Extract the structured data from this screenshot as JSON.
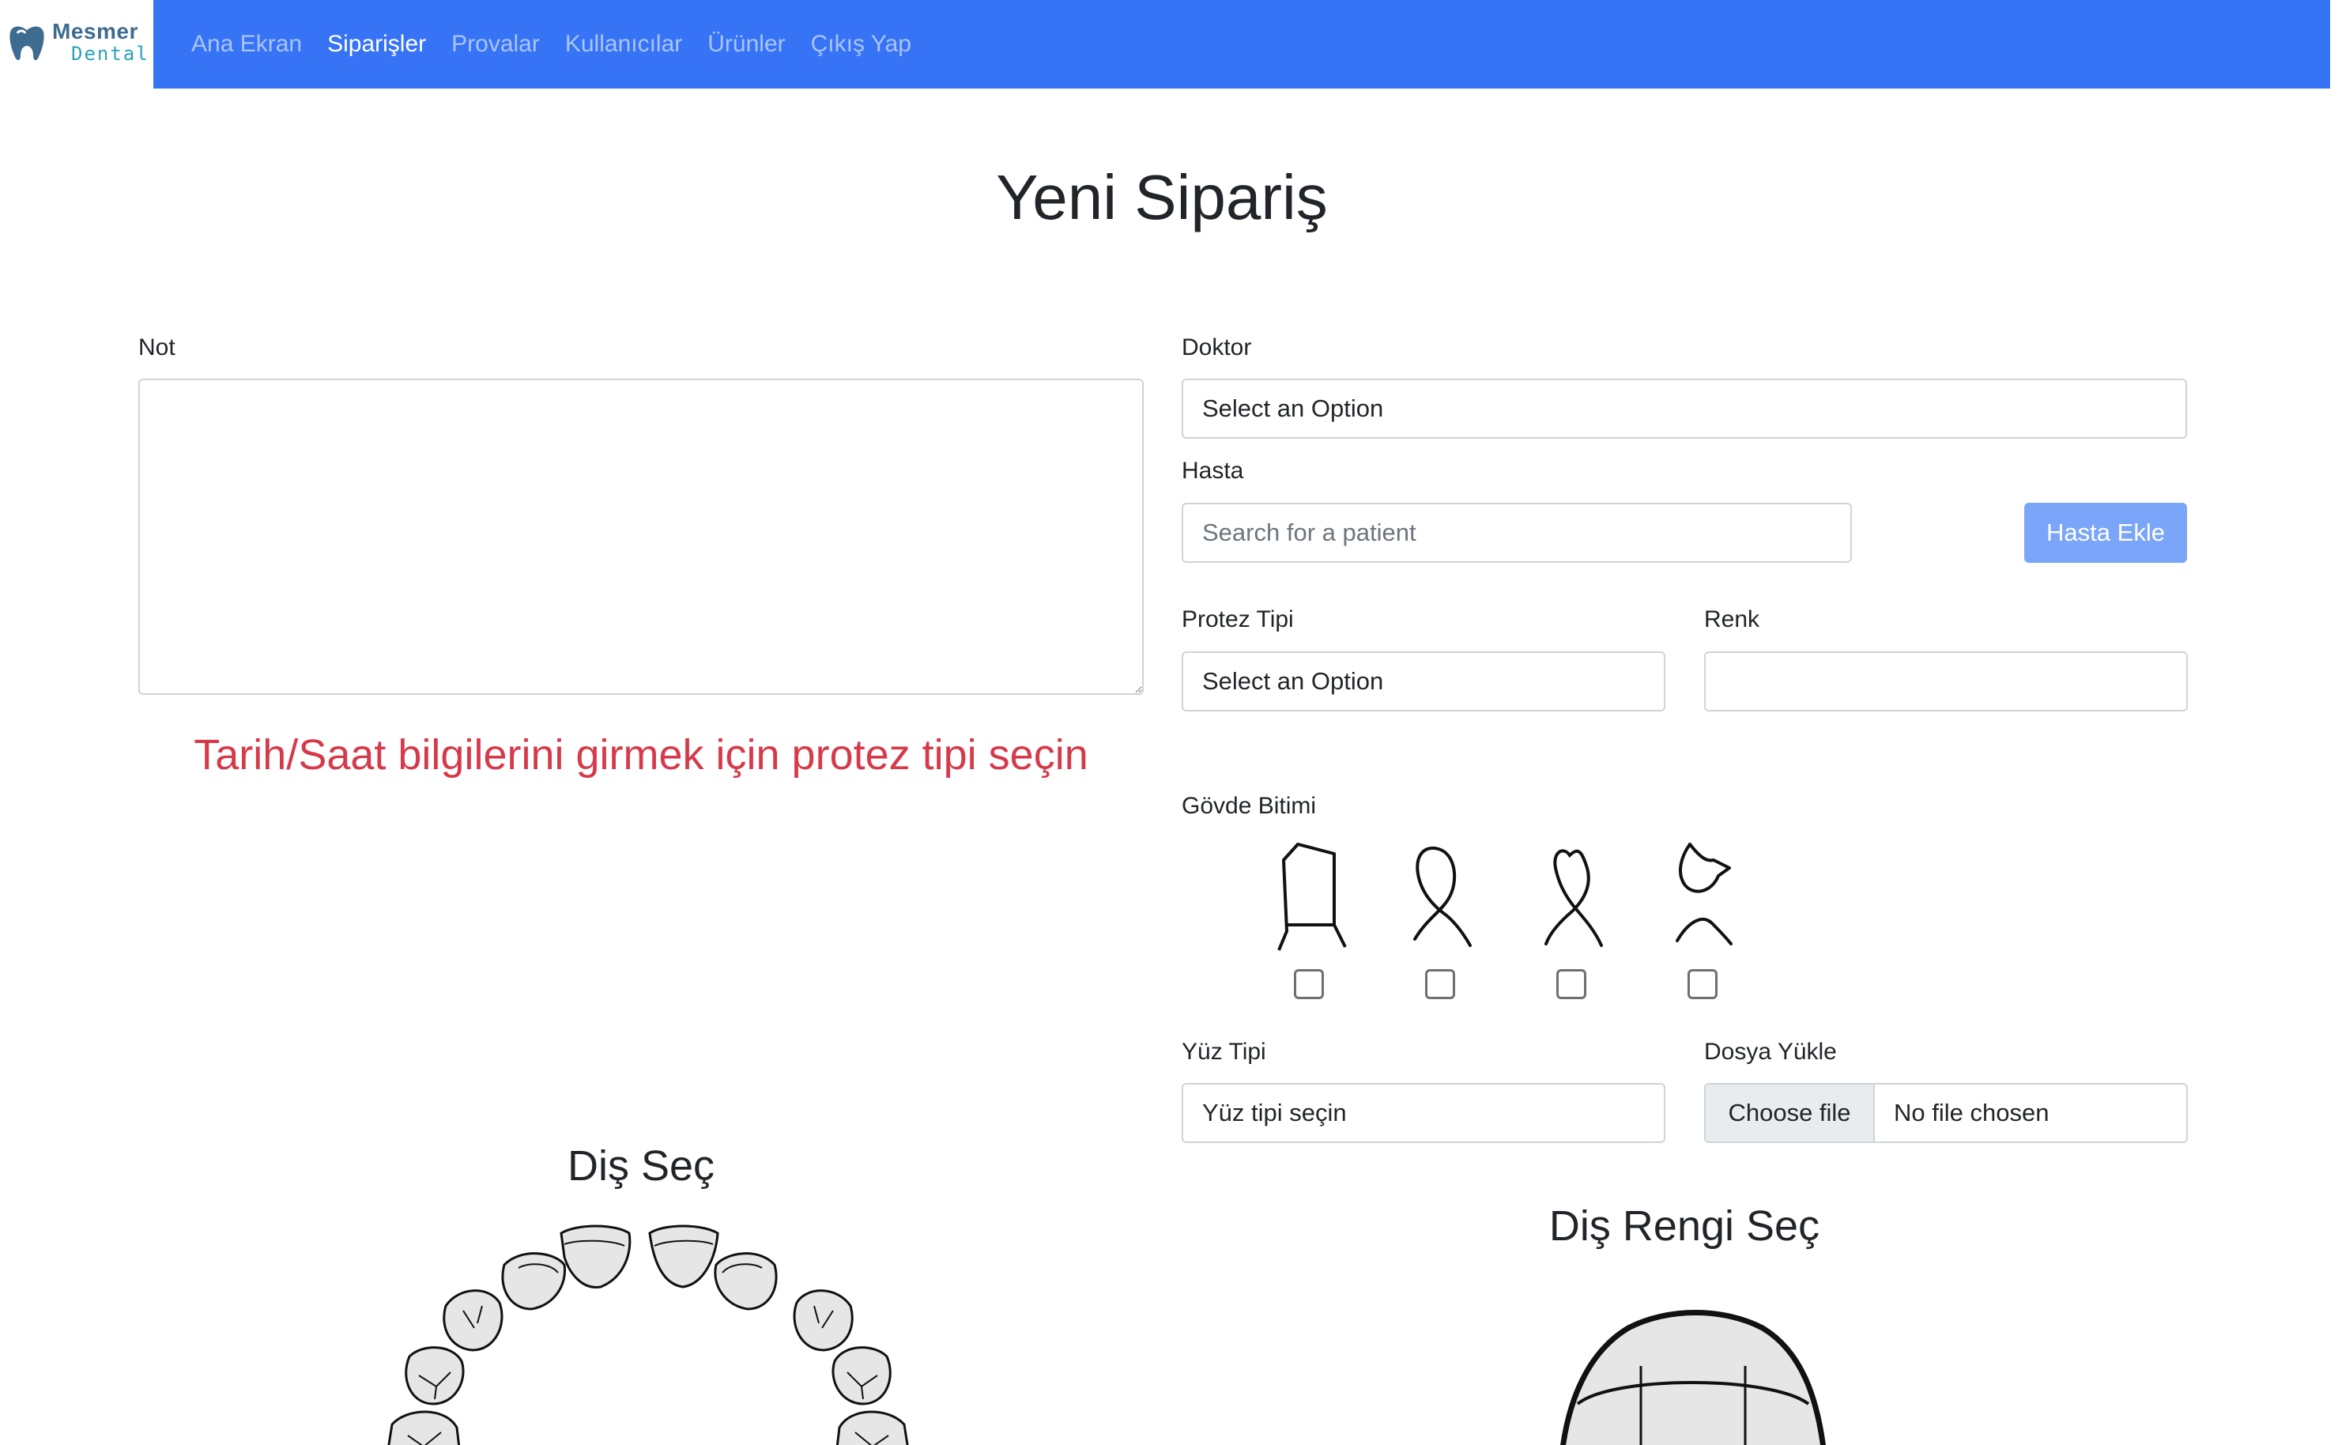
{
  "brand": {
    "name": "Mesmer",
    "sub": "Dental"
  },
  "nav": {
    "links": [
      "Ana Ekran",
      "Siparişler",
      "Provalar",
      "Kullanıcılar",
      "Ürünler",
      "Çıkış Yap"
    ],
    "active": "Siparişler"
  },
  "page": {
    "title": "Yeni Sipariş"
  },
  "form": {
    "note_label": "Not",
    "note_value": "",
    "doctor_label": "Doktor",
    "doctor_value": "Select an Option",
    "patient_label": "Hasta",
    "patient_placeholder": "Search for a patient",
    "add_patient_button": "Hasta Ekle",
    "prosthesis_type_label": "Protez Tipi",
    "prosthesis_type_value": "Select an Option",
    "color_label": "Renk",
    "color_value": "",
    "date_warning": "Tarih/Saat bilgilerini girmek için protez tipi seçin",
    "body_finish_label": "Gövde Bitimi",
    "body_finish_options": [
      {
        "icon": "shoulder-margin-icon",
        "checked": false
      },
      {
        "icon": "chamfer-margin-icon",
        "checked": false
      },
      {
        "icon": "knife-edge-margin-icon",
        "checked": false
      },
      {
        "icon": "open-margin-icon",
        "checked": false
      }
    ],
    "face_type_label": "Yüz Tipi",
    "face_type_value": "Yüz tipi seçin",
    "file_label": "Dosya Yükle",
    "file_button": "Choose file",
    "file_status": "No file chosen"
  },
  "teeth_section": {
    "title": "Diş Seç"
  },
  "shade_section": {
    "title": "Diş Rengi Seç"
  },
  "colors": {
    "navbar": "#3673f5",
    "warning": "#d63a4a",
    "add_button": "#7aa5f8",
    "tooth_fill": "#e6e6e6"
  }
}
